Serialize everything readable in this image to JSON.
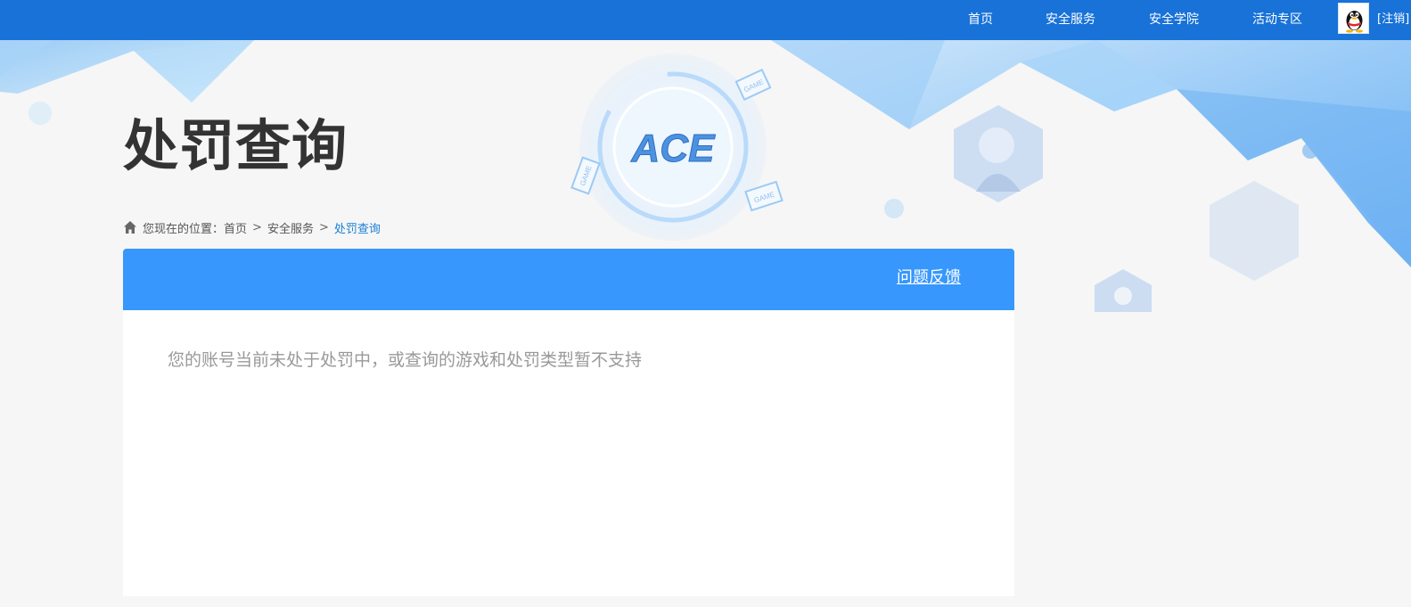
{
  "nav": {
    "items": [
      {
        "label": "首页"
      },
      {
        "label": "安全服务"
      },
      {
        "label": "安全学院"
      },
      {
        "label": "活动专区"
      }
    ],
    "logout_label": "[注销]",
    "avatar_icon": "qq-penguin-icon"
  },
  "banner": {
    "logo_text": "ACE",
    "badge_text": "GAME"
  },
  "page": {
    "title": "处罚查询"
  },
  "breadcrumb": {
    "prefix": "您现在的位置：",
    "items": [
      {
        "label": "首页"
      },
      {
        "label": "安全服务"
      }
    ],
    "separator": ">",
    "current": "处罚查询"
  },
  "panel": {
    "feedback_label": "问题反馈",
    "message": "您的账号当前未处于处罚中，或查询的游戏和处罚类型暂不支持"
  },
  "colors": {
    "nav_bg": "#1872d8",
    "panel_header": "#3797fd",
    "link_active": "#1a7fd6"
  }
}
